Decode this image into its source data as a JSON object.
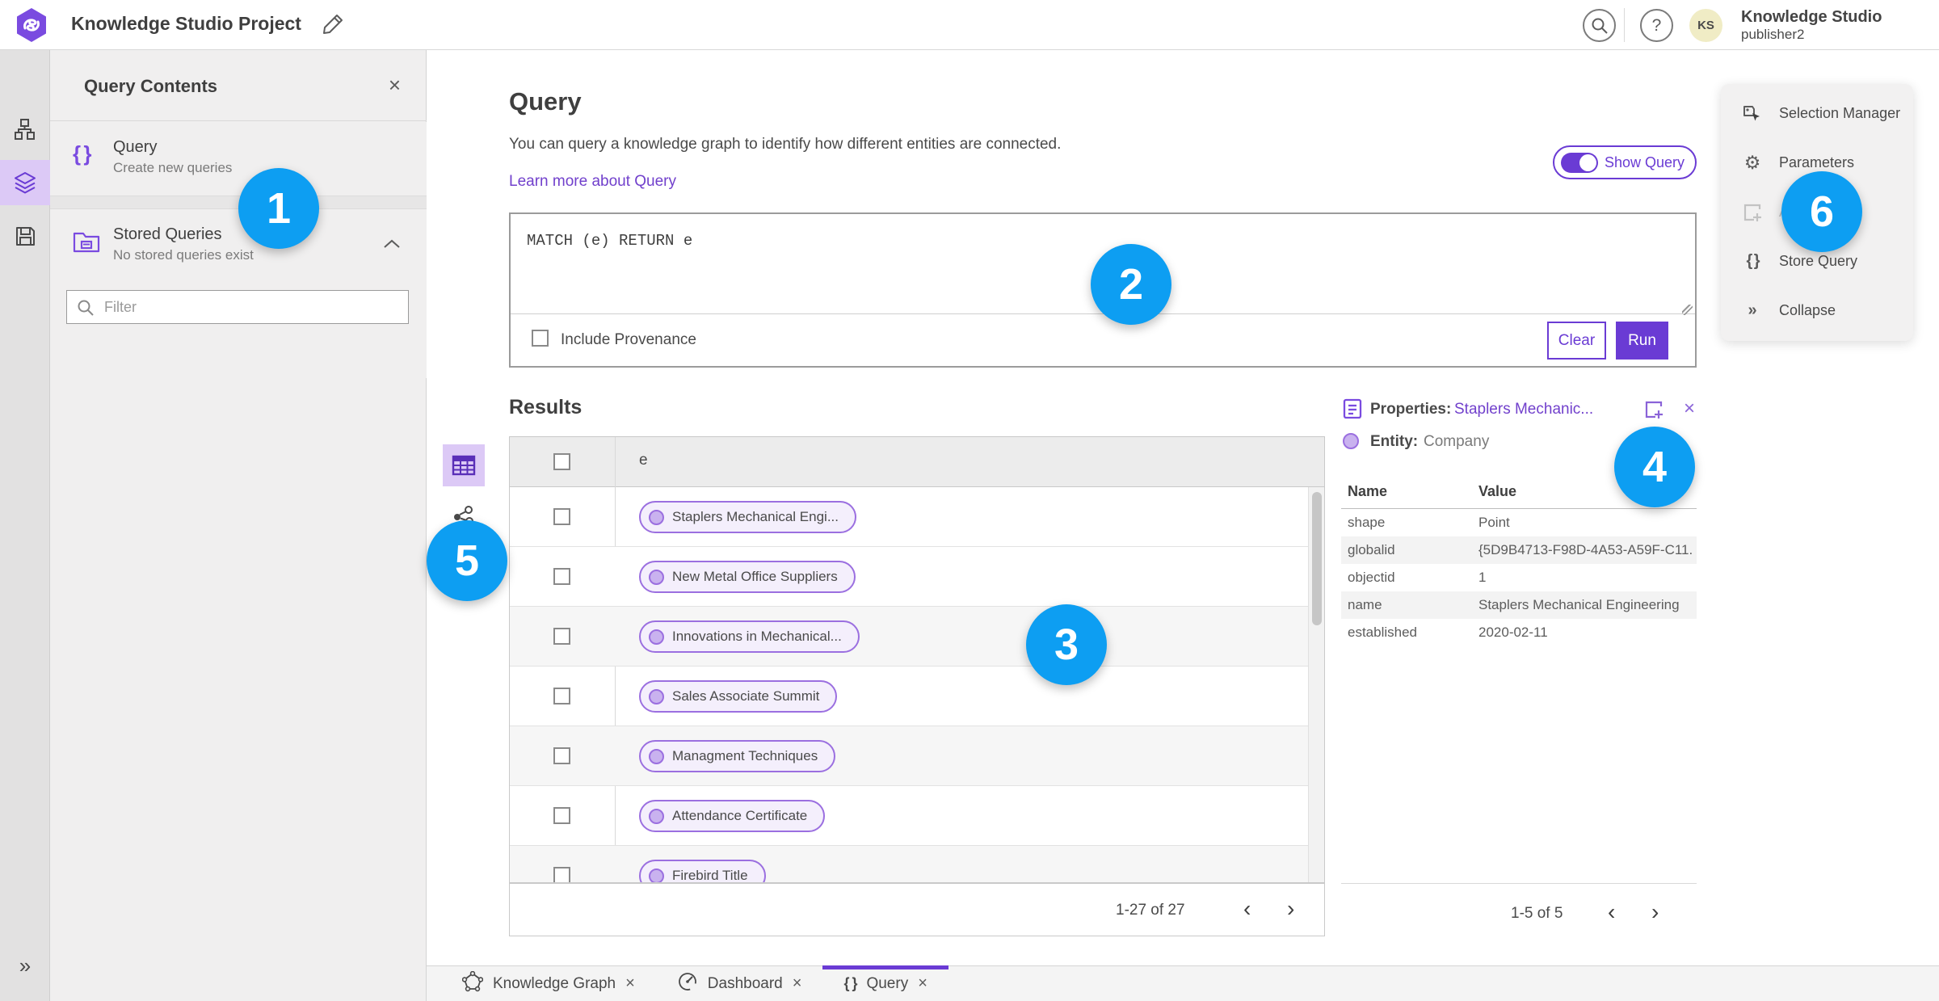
{
  "topbar": {
    "title": "Knowledge Studio Project",
    "user_name": "Knowledge Studio",
    "user_role": "publisher2",
    "avatar_initials": "KS"
  },
  "query_contents": {
    "header": "Query Contents",
    "query_item": {
      "title": "Query",
      "subtitle": "Create new queries"
    },
    "stored_item": {
      "title": "Stored Queries",
      "subtitle": "No stored queries exist"
    },
    "filter_placeholder": "Filter"
  },
  "query": {
    "title": "Query",
    "description": "You can query a knowledge graph to identify how different entities are connected.",
    "learn_more": "Learn more about Query",
    "show_query_label": "Show Query",
    "code": "MATCH (e) RETURN e",
    "include_provenance_label": "Include Provenance",
    "clear_label": "Clear",
    "run_label": "Run"
  },
  "results": {
    "title": "Results",
    "column": "e",
    "rows": [
      "Staplers Mechanical Engi...",
      "New Metal Office Suppliers",
      "Innovations in Mechanical...",
      "Sales Associate Summit",
      "Managment Techniques",
      "Attendance Certificate",
      "Firebird Title"
    ],
    "pagination": "1-27 of 27"
  },
  "properties": {
    "label": "Properties:",
    "selected": "Staplers Mechanic...",
    "entity_label": "Entity:",
    "entity_type": "Company",
    "col_name": "Name",
    "col_value": "Value",
    "rows": [
      {
        "name": "shape",
        "value": "Point"
      },
      {
        "name": "globalid",
        "value": "{5D9B4713-F98D-4A53-A59F-C11..."
      },
      {
        "name": "objectid",
        "value": "1"
      },
      {
        "name": "name",
        "value": "Staplers Mechanical Engineering"
      },
      {
        "name": "established",
        "value": "2020-02-11"
      }
    ],
    "pagination": "1-5 of 5"
  },
  "right_menu": {
    "items": [
      {
        "label": "Selection Manager"
      },
      {
        "label": "Parameters"
      },
      {
        "label": "Ad",
        "disabled": true
      },
      {
        "label": "Store Query"
      },
      {
        "label": "Collapse"
      }
    ]
  },
  "tabs": [
    {
      "label": "Knowledge Graph"
    },
    {
      "label": "Dashboard"
    },
    {
      "label": "Query",
      "active": true
    }
  ],
  "badges": [
    "1",
    "2",
    "3",
    "4",
    "5",
    "6"
  ],
  "icons": {
    "help": "?",
    "close": "×",
    "braces": "{ }",
    "collapse_double": "»",
    "chevron_left": "‹",
    "chevron_right": "›",
    "gear": "⚙"
  },
  "colors": {
    "accent_purple": "#6a3bd4",
    "link_purple": "#7140cc",
    "badge_blue": "#0d9ef2",
    "chip_border": "#9b6fe0",
    "chip_fill": "#f4effc",
    "selected_rail": "#dcc9f6",
    "avatar_bg": "#f0ecc5"
  }
}
